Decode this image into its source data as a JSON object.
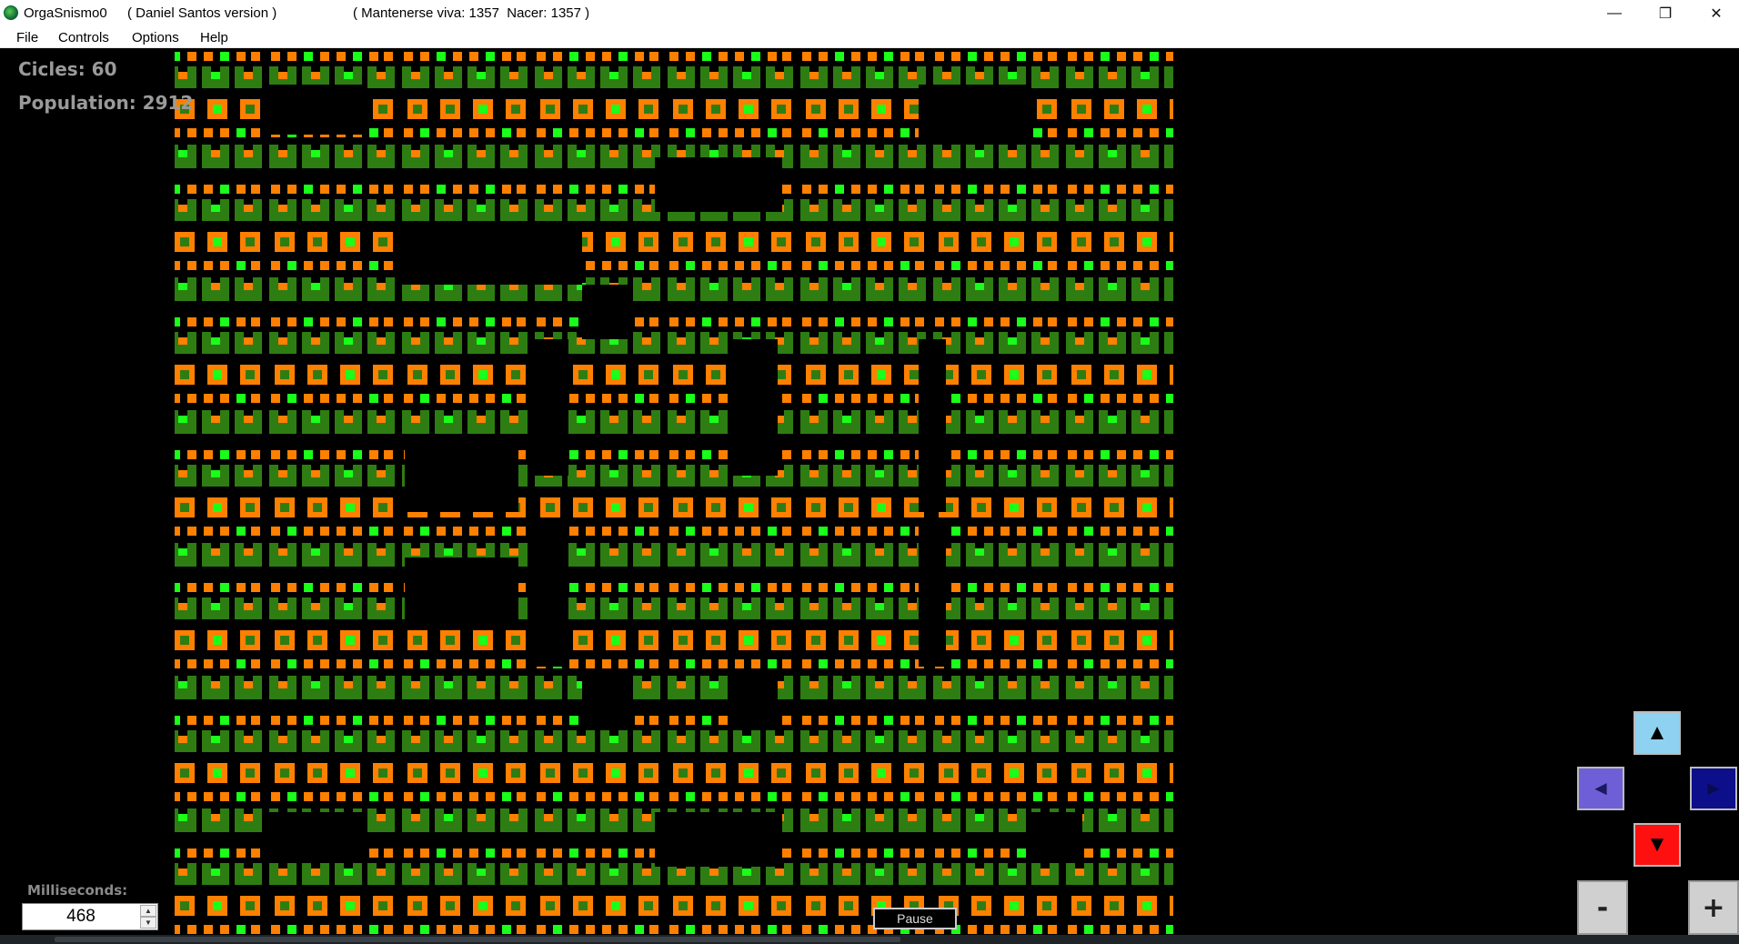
{
  "window": {
    "app_name": "OrgaSnismo0",
    "version_label": "( Daniel Santos version )",
    "rules_label": "( Mantenerse viva: 1357  Nacer: 1357 )",
    "controls": {
      "minimize": "—",
      "maximize": "❐",
      "close": "✕"
    }
  },
  "menu": {
    "items": [
      "File",
      "Controls",
      "Options",
      "Help"
    ]
  },
  "stats": {
    "cycles_text": "Cicles: 60",
    "population_text": "Population: 2912"
  },
  "speed": {
    "label": "Milliseconds:",
    "value": "468"
  },
  "buttons": {
    "pause": "Pause",
    "zoom_out": "-",
    "zoom_in": "+",
    "up": "▲",
    "left": "◄",
    "right": "►",
    "down": "▼"
  },
  "colors": {
    "background": "#000000",
    "cell_orange": "#ff8000",
    "cell_green": "#1aff1a",
    "cell_dark": "#2e7d12",
    "nav_up": "#8fd1f0",
    "nav_left": "#6f5fd6",
    "nav_right": "#0d0f8a",
    "nav_down": "#ff1010"
  }
}
